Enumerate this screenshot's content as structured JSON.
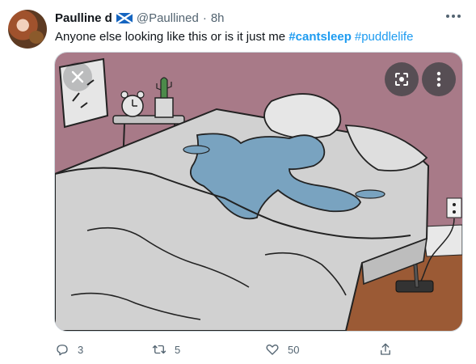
{
  "tweet": {
    "author_name": "Paulline d",
    "handle": "@Paullined",
    "separator": "·",
    "time": "8h",
    "text": "Anyone else looking like this or is it just me",
    "hashtags": [
      "#cantsleep",
      "#puddlelife"
    ]
  },
  "actions": {
    "reply_count": "3",
    "retweet_count": "5",
    "like_count": "50"
  },
  "icons": {
    "flag": "scotland-flag-icon",
    "more": "more-horizontal-icon",
    "close": "close-icon",
    "lens": "lens-icon",
    "kebab": "more-vertical-icon",
    "reply": "reply-icon",
    "retweet": "retweet-icon",
    "like": "heart-icon",
    "share": "share-icon"
  },
  "colors": {
    "accent": "#1d9bf0",
    "text": "#0f1419",
    "secondary": "#536471",
    "wall": "#a87a88",
    "floor": "#9b5a35",
    "sheet": "#d1d1d1",
    "puddle": "#79a3c0"
  }
}
